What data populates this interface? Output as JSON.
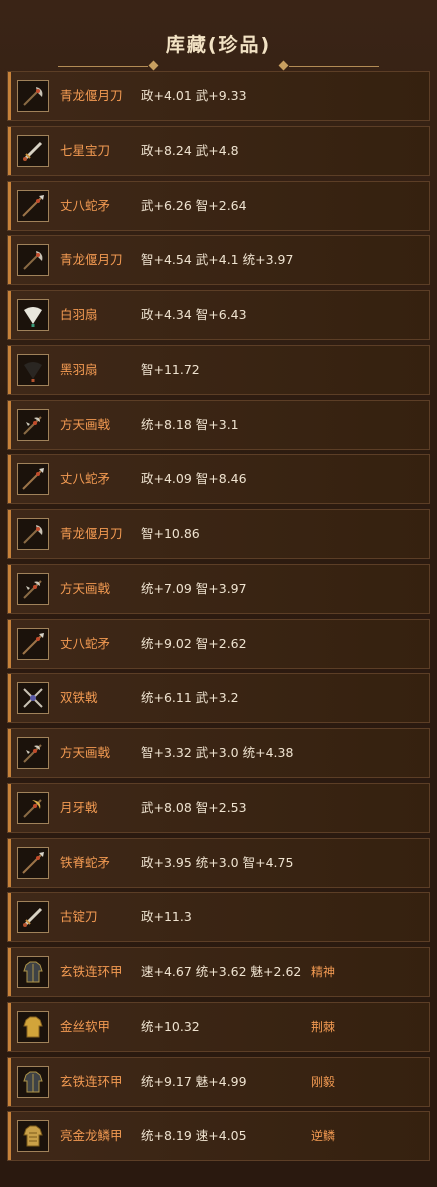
{
  "header": {
    "title": "库藏(珍品)"
  },
  "items": [
    {
      "name": "青龙偃月刀",
      "stats": "政+4.01 武+9.33",
      "tag": "",
      "icon": "glaive-icon"
    },
    {
      "name": "七星宝刀",
      "stats": "政+8.24 武+4.8",
      "tag": "",
      "icon": "sword-icon"
    },
    {
      "name": "丈八蛇矛",
      "stats": "武+6.26 智+2.64",
      "tag": "",
      "icon": "spear-icon"
    },
    {
      "name": "青龙偃月刀",
      "stats": "智+4.54 武+4.1 统+3.97",
      "tag": "",
      "icon": "glaive-icon"
    },
    {
      "name": "白羽扇",
      "stats": "政+4.34 智+6.43",
      "tag": "",
      "icon": "white-fan-icon"
    },
    {
      "name": "黑羽扇",
      "stats": "智+11.72",
      "tag": "",
      "icon": "black-fan-icon"
    },
    {
      "name": "方天画戟",
      "stats": "统+8.18 智+3.1",
      "tag": "",
      "icon": "halberd-icon"
    },
    {
      "name": "丈八蛇矛",
      "stats": "政+4.09 智+8.46",
      "tag": "",
      "icon": "spear-icon"
    },
    {
      "name": "青龙偃月刀",
      "stats": "智+10.86",
      "tag": "",
      "icon": "glaive-icon"
    },
    {
      "name": "方天画戟",
      "stats": "统+7.09 智+3.97",
      "tag": "",
      "icon": "halberd-icon"
    },
    {
      "name": "丈八蛇矛",
      "stats": "统+9.02 智+2.62",
      "tag": "",
      "icon": "spear-icon"
    },
    {
      "name": "双铁戟",
      "stats": "统+6.11 武+3.2",
      "tag": "",
      "icon": "twin-halberd-icon"
    },
    {
      "name": "方天画戟",
      "stats": "智+3.32 武+3.0 统+4.38",
      "tag": "",
      "icon": "halberd-icon"
    },
    {
      "name": "月牙戟",
      "stats": "武+8.08 智+2.53",
      "tag": "",
      "icon": "crescent-halberd-icon"
    },
    {
      "name": "铁脊蛇矛",
      "stats": "政+3.95 统+3.0 智+4.75",
      "tag": "",
      "icon": "spear-icon"
    },
    {
      "name": "古锭刀",
      "stats": "政+11.3",
      "tag": "",
      "icon": "sword-icon"
    },
    {
      "name": "玄铁连环甲",
      "stats": "速+4.67 统+3.62 魅+2.62",
      "tag": "精神",
      "icon": "iron-armor-icon"
    },
    {
      "name": "金丝软甲",
      "stats": "统+10.32",
      "tag": "荆棘",
      "icon": "gold-armor-icon"
    },
    {
      "name": "玄铁连环甲",
      "stats": "统+9.17 魅+4.99",
      "tag": "刚毅",
      "icon": "iron-armor-icon"
    },
    {
      "name": "亮金龙鳞甲",
      "stats": "统+8.19 速+4.05",
      "tag": "逆鳞",
      "icon": "dragon-armor-icon"
    }
  ]
}
